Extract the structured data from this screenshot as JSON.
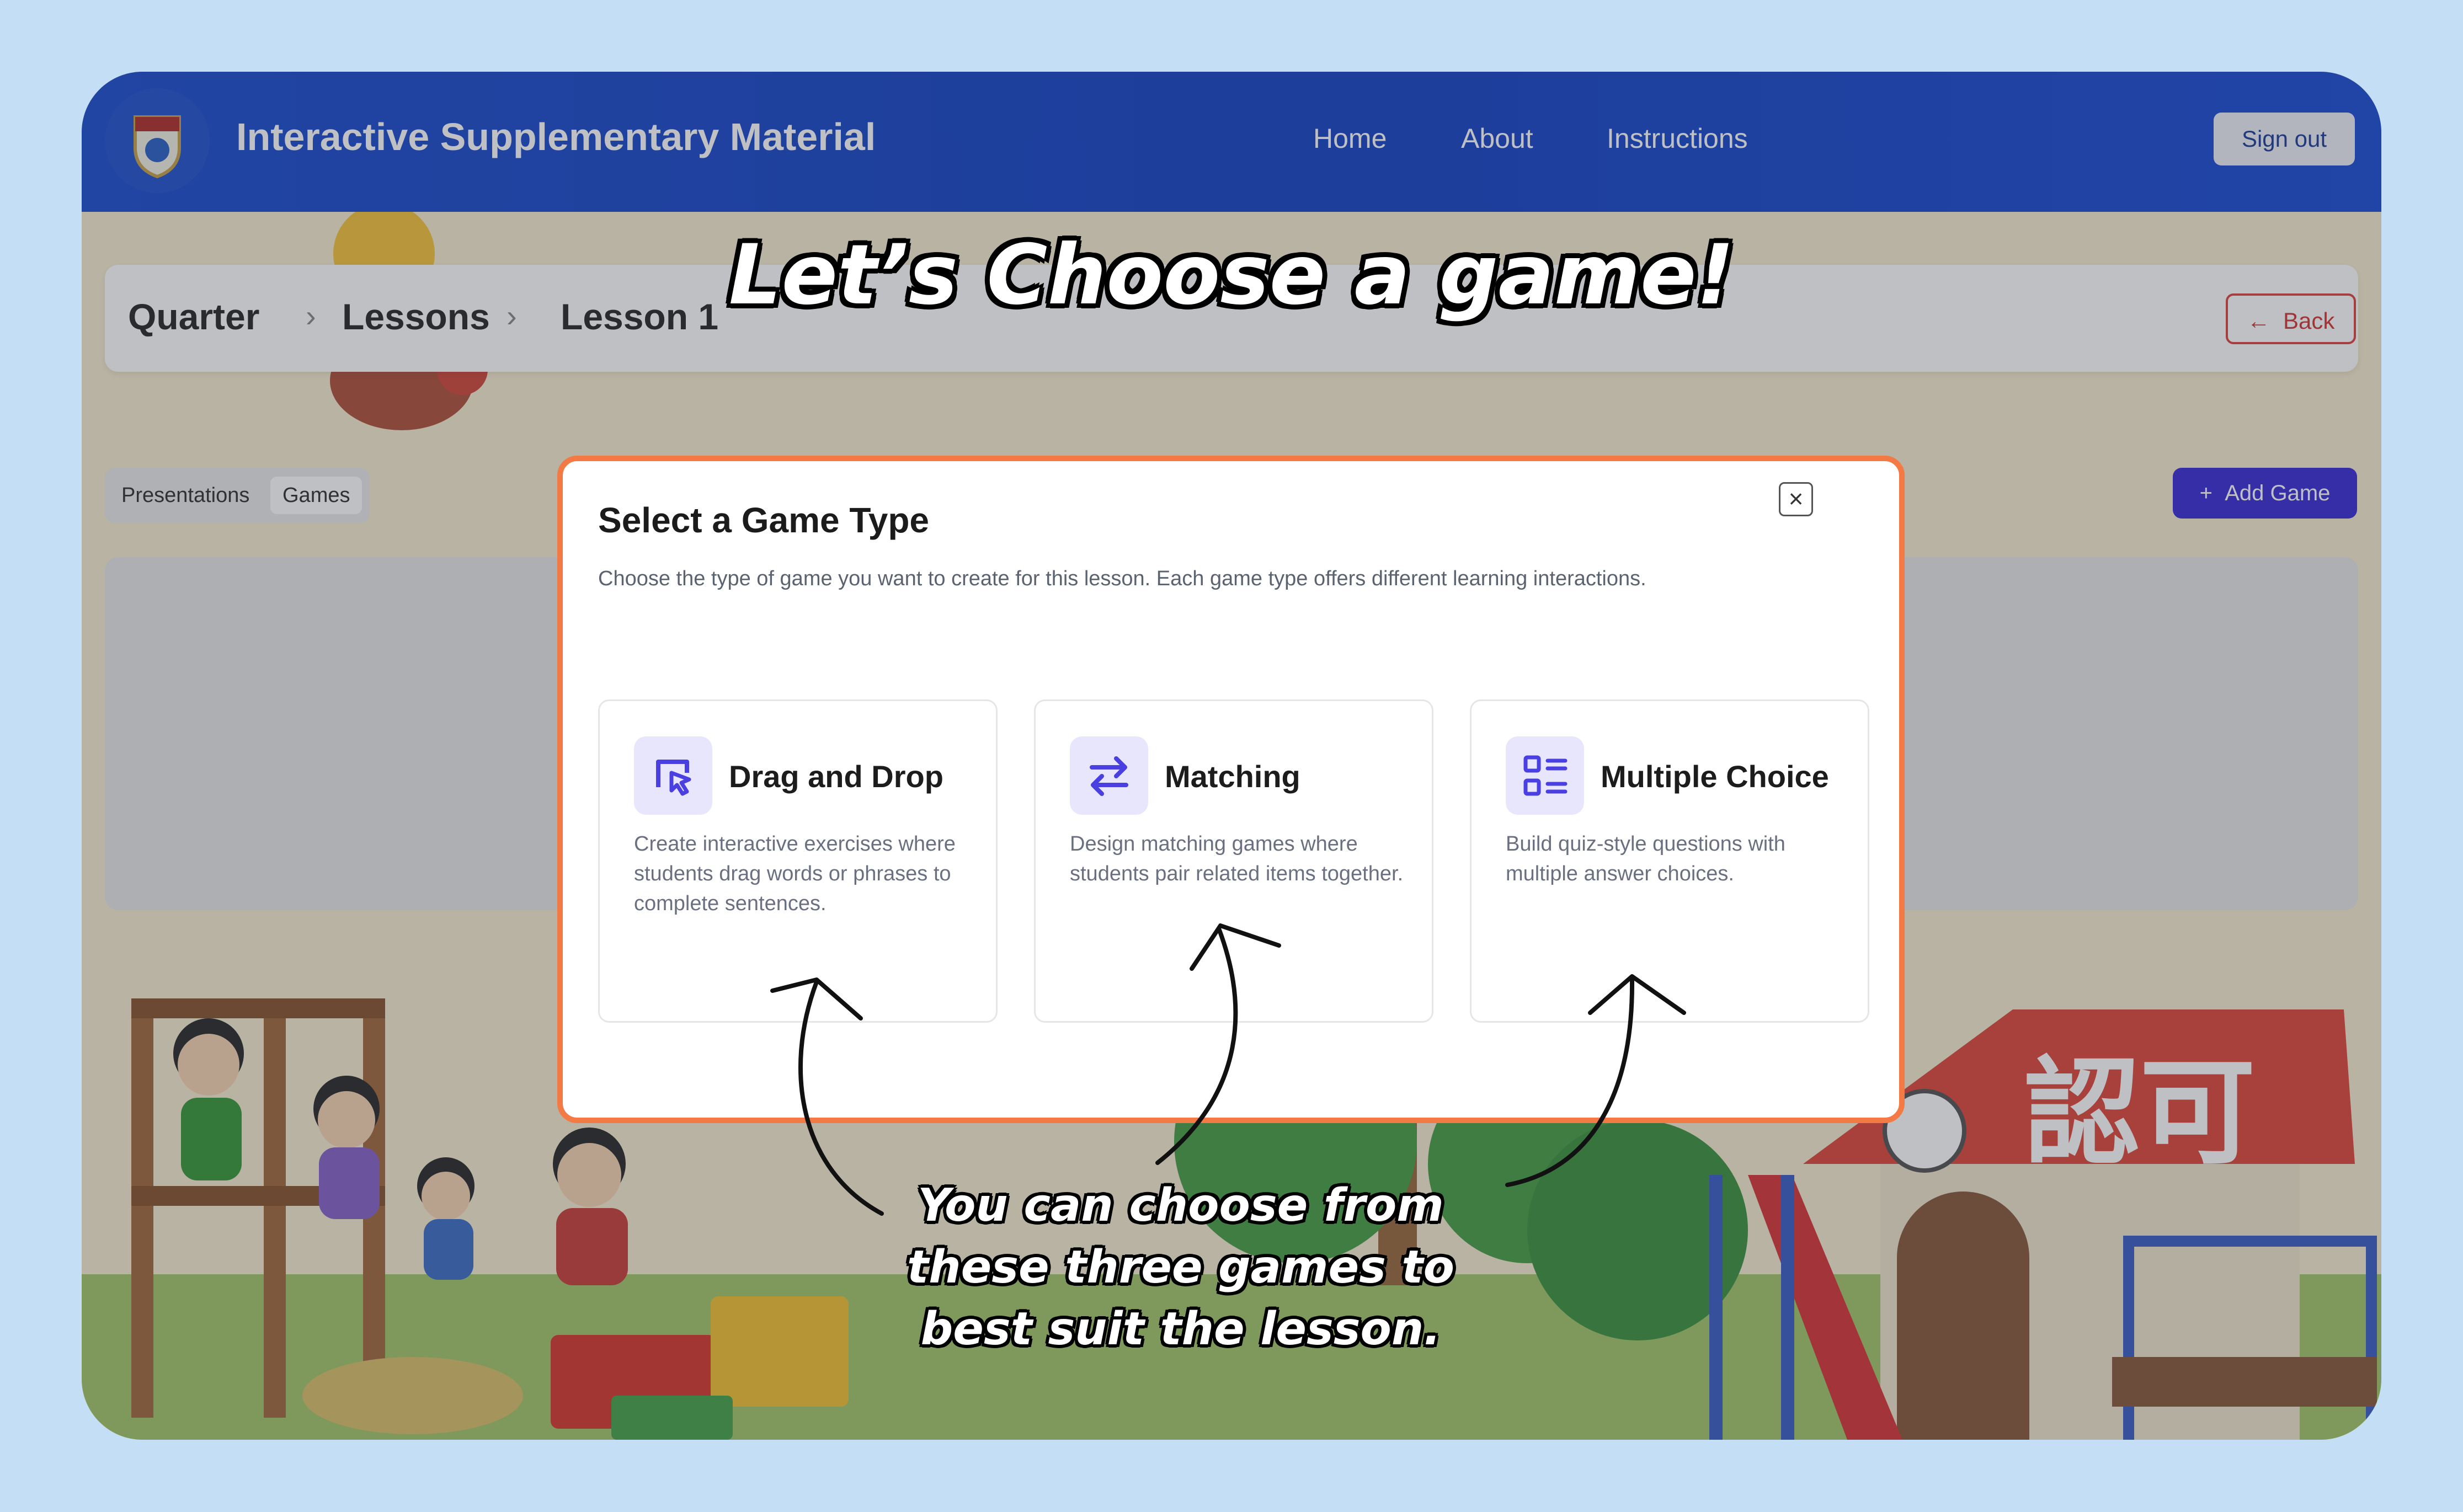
{
  "header": {
    "app_title": "Interactive Supplementary Material",
    "nav": [
      "Home",
      "About",
      "Instructions"
    ],
    "sign_out": "Sign out"
  },
  "breadcrumb": [
    "Quarter",
    "Lessons",
    "Lesson 1"
  ],
  "back_label": "Back",
  "tabs": [
    "Presentations",
    "Games"
  ],
  "add_game_label": "Add Game",
  "modal": {
    "title": "Select a Game Type",
    "description": "Choose the type of game you want to create for this lesson. Each game type offers different learning interactions.",
    "close": "×",
    "options": [
      {
        "title": "Drag and Drop",
        "description": "Create interactive exercises where students drag words or phrases to complete sentences.",
        "icon": "drag-drop-icon"
      },
      {
        "title": "Matching",
        "description": "Design matching games where students pair related items together.",
        "icon": "swap-arrows-icon"
      },
      {
        "title": "Multiple Choice",
        "description": "Build quiz-style questions with multiple answer choices.",
        "icon": "list-choice-icon"
      }
    ]
  },
  "annotation": {
    "headline": "Let’s Choose a game!",
    "caption_lines": [
      "You can choose from",
      "these three games to",
      "best suit the lesson."
    ]
  },
  "colors": {
    "navbar": "#1f4fd0",
    "accent_purple": "#3b2fd6",
    "modal_border": "#f37a44",
    "back_red": "#e0443f",
    "page_bg": "#c3def5"
  }
}
